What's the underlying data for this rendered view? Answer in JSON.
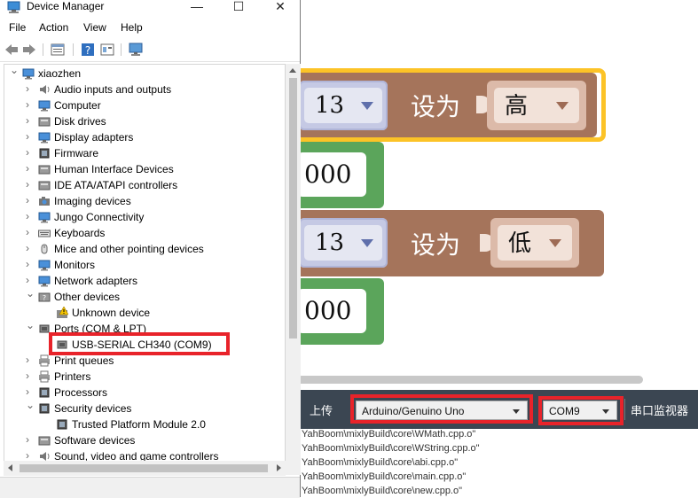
{
  "window": {
    "title": "Device Manager",
    "controls": {
      "minimize": "—",
      "maximize": "☐",
      "close": "✕"
    }
  },
  "menu": [
    "File",
    "Action",
    "View",
    "Help"
  ],
  "tree": {
    "root": "xiaozhen",
    "items": [
      {
        "label": "Audio inputs and outputs",
        "icon": "speaker-icon",
        "expanded": false
      },
      {
        "label": "Computer",
        "icon": "computer-icon",
        "expanded": false
      },
      {
        "label": "Disk drives",
        "icon": "disk-drive-icon",
        "expanded": false
      },
      {
        "label": "Display adapters",
        "icon": "display-adapter-icon",
        "expanded": false
      },
      {
        "label": "Firmware",
        "icon": "firmware-icon",
        "expanded": false
      },
      {
        "label": "Human Interface Devices",
        "icon": "hid-icon",
        "expanded": false
      },
      {
        "label": "IDE ATA/ATAPI controllers",
        "icon": "ide-controller-icon",
        "expanded": false
      },
      {
        "label": "Imaging devices",
        "icon": "camera-icon",
        "expanded": false
      },
      {
        "label": "Jungo Connectivity",
        "icon": "network-device-icon",
        "expanded": false
      },
      {
        "label": "Keyboards",
        "icon": "keyboard-icon",
        "expanded": false
      },
      {
        "label": "Mice and other pointing devices",
        "icon": "mouse-icon",
        "expanded": false
      },
      {
        "label": "Monitors",
        "icon": "monitor-icon",
        "expanded": false
      },
      {
        "label": "Network adapters",
        "icon": "network-adapter-icon",
        "expanded": false
      },
      {
        "label": "Other devices",
        "icon": "other-devices-icon",
        "expanded": true,
        "children": [
          {
            "label": "Unknown device",
            "icon": "unknown-device-warning-icon"
          }
        ]
      },
      {
        "label": "Ports (COM & LPT)",
        "icon": "port-icon",
        "expanded": true,
        "children": [
          {
            "label": "USB-SERIAL CH340 (COM9)",
            "icon": "serial-port-icon"
          }
        ]
      },
      {
        "label": "Print queues",
        "icon": "print-queue-icon",
        "expanded": false
      },
      {
        "label": "Printers",
        "icon": "printer-icon",
        "expanded": false
      },
      {
        "label": "Processors",
        "icon": "processor-icon",
        "expanded": false
      },
      {
        "label": "Security devices",
        "icon": "security-device-icon",
        "expanded": true,
        "children": [
          {
            "label": "Trusted Platform Module 2.0",
            "icon": "tpm-icon"
          }
        ]
      },
      {
        "label": "Software devices",
        "icon": "software-device-icon",
        "expanded": false
      },
      {
        "label": "Sound, video and game controllers",
        "icon": "sound-icon",
        "expanded": false
      }
    ]
  },
  "blocks": {
    "pin1": "13",
    "set_label1": "设为",
    "value1": "高",
    "delay1": "000",
    "pin2": "13",
    "set_label2": "设为",
    "value2": "低",
    "delay2": "000"
  },
  "mixly_toolbar": {
    "upload": "上传",
    "board": "Arduino/Genuino Uno",
    "port": "COM9",
    "serial_monitor": "串口监视器"
  },
  "console": [
    "YahBoom\\mixlyBuild\\core\\WMath.cpp.o\"",
    "YahBoom\\mixlyBuild\\core\\WString.cpp.o\"",
    "YahBoom\\mixlyBuild\\core\\abi.cpp.o\"",
    "YahBoom\\mixlyBuild\\core\\main.cpp.o\"",
    "YahBoom\\mixlyBuild\\core\\new.cpp.o\""
  ],
  "colors": {
    "block_brown": "#a5745b",
    "block_green": "#5ba55b",
    "highlight_yellow": "#fcc327",
    "annotation_red": "#e8232a",
    "toolbar_dark": "#3b4652"
  }
}
